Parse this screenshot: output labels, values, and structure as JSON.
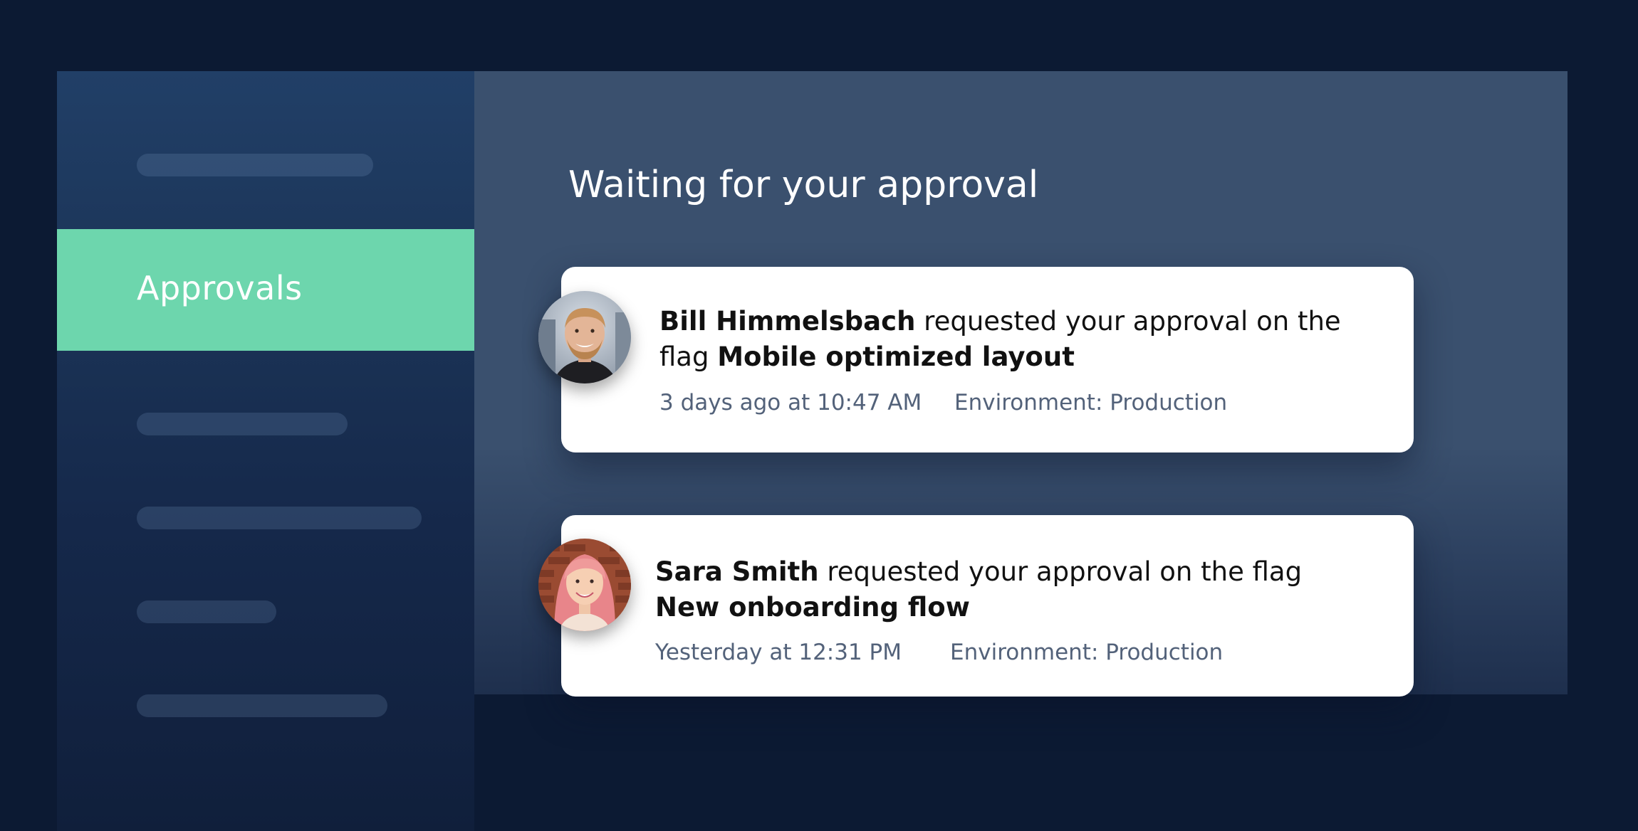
{
  "sidebar": {
    "active_label": "Approvals"
  },
  "main": {
    "title": "Waiting for your approval"
  },
  "approvals": [
    {
      "requester": "Bill Himmelsbach",
      "action": " requested your approval on the flag ",
      "flag": "Mobile optimized layout",
      "time": "3 days ago at 10:47 AM",
      "environment": "Environment: Production"
    },
    {
      "requester": "Sara Smith",
      "action": " requested your approval on the flag ",
      "flag": "New onboarding flow",
      "time": "Yesterday at 12:31 PM",
      "environment": "Environment: Production"
    }
  ],
  "colors": {
    "background": "#0c1a33",
    "sidebar": "#1b3457",
    "active": "#6dd6ad",
    "panel": "#3a506e",
    "card": "#ffffff",
    "meta_text": "#53627a"
  },
  "icons": [
    "avatar-bill",
    "avatar-sara"
  ]
}
